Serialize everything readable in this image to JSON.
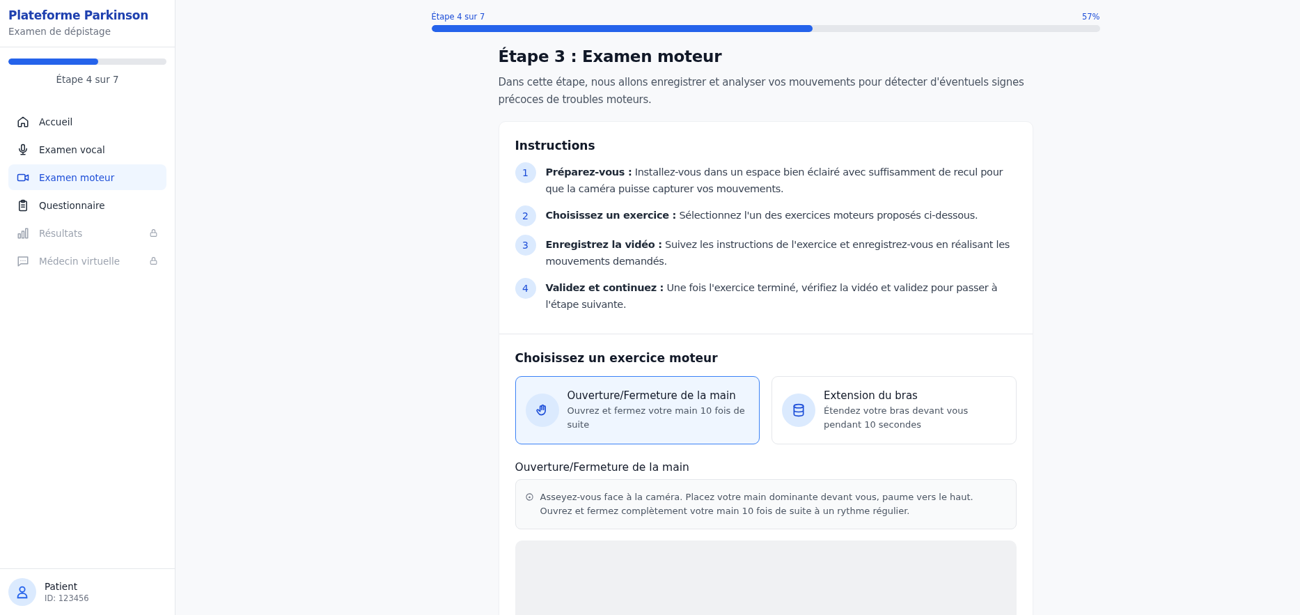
{
  "sidebar": {
    "title": "Plateforme Parkinson",
    "subtitle": "Examen de dépistage",
    "progress": {
      "level": 0.57,
      "label": "Étape 4 sur 7"
    },
    "items": [
      {
        "label": "Accueil",
        "selected": false,
        "locked": false
      },
      {
        "label": "Examen vocal",
        "selected": false,
        "locked": false
      },
      {
        "label": "Examen moteur",
        "selected": true,
        "locked": false
      },
      {
        "label": "Questionnaire",
        "selected": false,
        "locked": false
      },
      {
        "label": "Résultats",
        "selected": false,
        "locked": true
      },
      {
        "label": "Médecin virtuelle",
        "selected": false,
        "locked": true
      }
    ],
    "user": {
      "name": "Patient",
      "id": "ID: 123456"
    }
  },
  "progress": {
    "label": "Étape 4 sur 7",
    "percent": "57%",
    "level": 0.57
  },
  "page": {
    "title": "Étape 3 : Examen moteur",
    "description": "Dans cette étape, nous allons enregistrer et analyser vos mouvements pour détecter d'éventuels signes précoces de troubles moteurs."
  },
  "instructions": {
    "title": "Instructions",
    "steps": [
      {
        "number": "1",
        "text": "**Préparez-vous :** Installez-vous dans un espace bien éclairé avec suffisamment de recul pour que la caméra puisse capturer vos mouvements."
      },
      {
        "number": "2",
        "text": "**Choisissez un exercice :** Sélectionnez l'un des exercices moteurs proposés ci-dessous."
      },
      {
        "number": "3",
        "text": "**Enregistrez la vidéo :** Suivez les instructions de l'exercice et enregistrez-vous en réalisant les mouvements demandés."
      },
      {
        "number": "4",
        "text": "**Validez et continuez :** Une fois l'exercice terminé, vérifiez la vidéo et validez pour passer à l'étape suivante."
      }
    ]
  },
  "exercises": {
    "title": "Choisissez un exercice moteur",
    "items": [
      {
        "title": "Ouverture/Fermeture de la main",
        "description": "Ouvrez et fermez votre main 10 fois de suite",
        "selected": true
      },
      {
        "title": "Extension du bras",
        "description": "Étendez votre bras devant vous pendant 10 secondes",
        "selected": false
      }
    ],
    "detail_title": "Ouverture/Fermeture de la main",
    "detail_text": "Asseyez-vous face à la caméra. Placez votre main dominante devant vous, paume vers le haut. Ouvrez et fermez complètement votre main 10 fois de suite à un rythme régulier."
  }
}
